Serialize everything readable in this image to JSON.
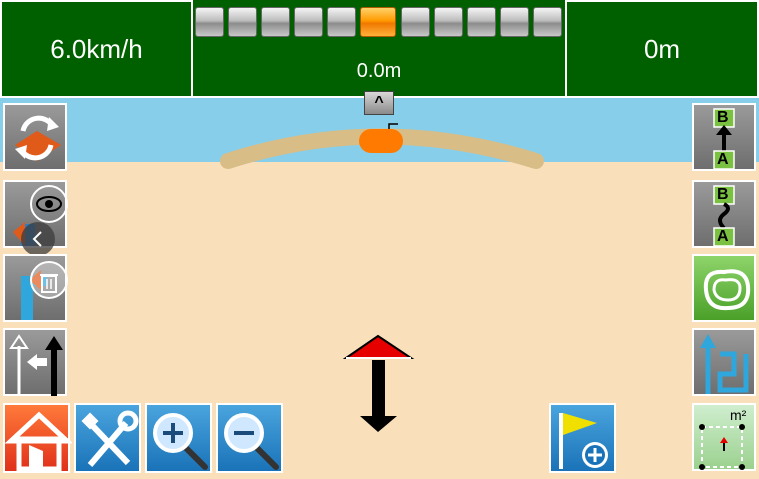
{
  "status": {
    "speed": "6.0km/h",
    "distance": "0m",
    "offset": "0.0m"
  },
  "lightbar": {
    "segments": 11,
    "active_index": 5
  },
  "collapse_label": "^",
  "area_button": {
    "unit_label": "m²"
  },
  "ab_buttons": {
    "a_label": "A",
    "b_label": "B"
  },
  "colors": {
    "panel_green": "#006000",
    "sky": "#87ceeb",
    "ground": "#f9e0bb",
    "track": "#d8bd87",
    "implement": "#ff7a00",
    "tractor_arrow": "#e60000"
  }
}
